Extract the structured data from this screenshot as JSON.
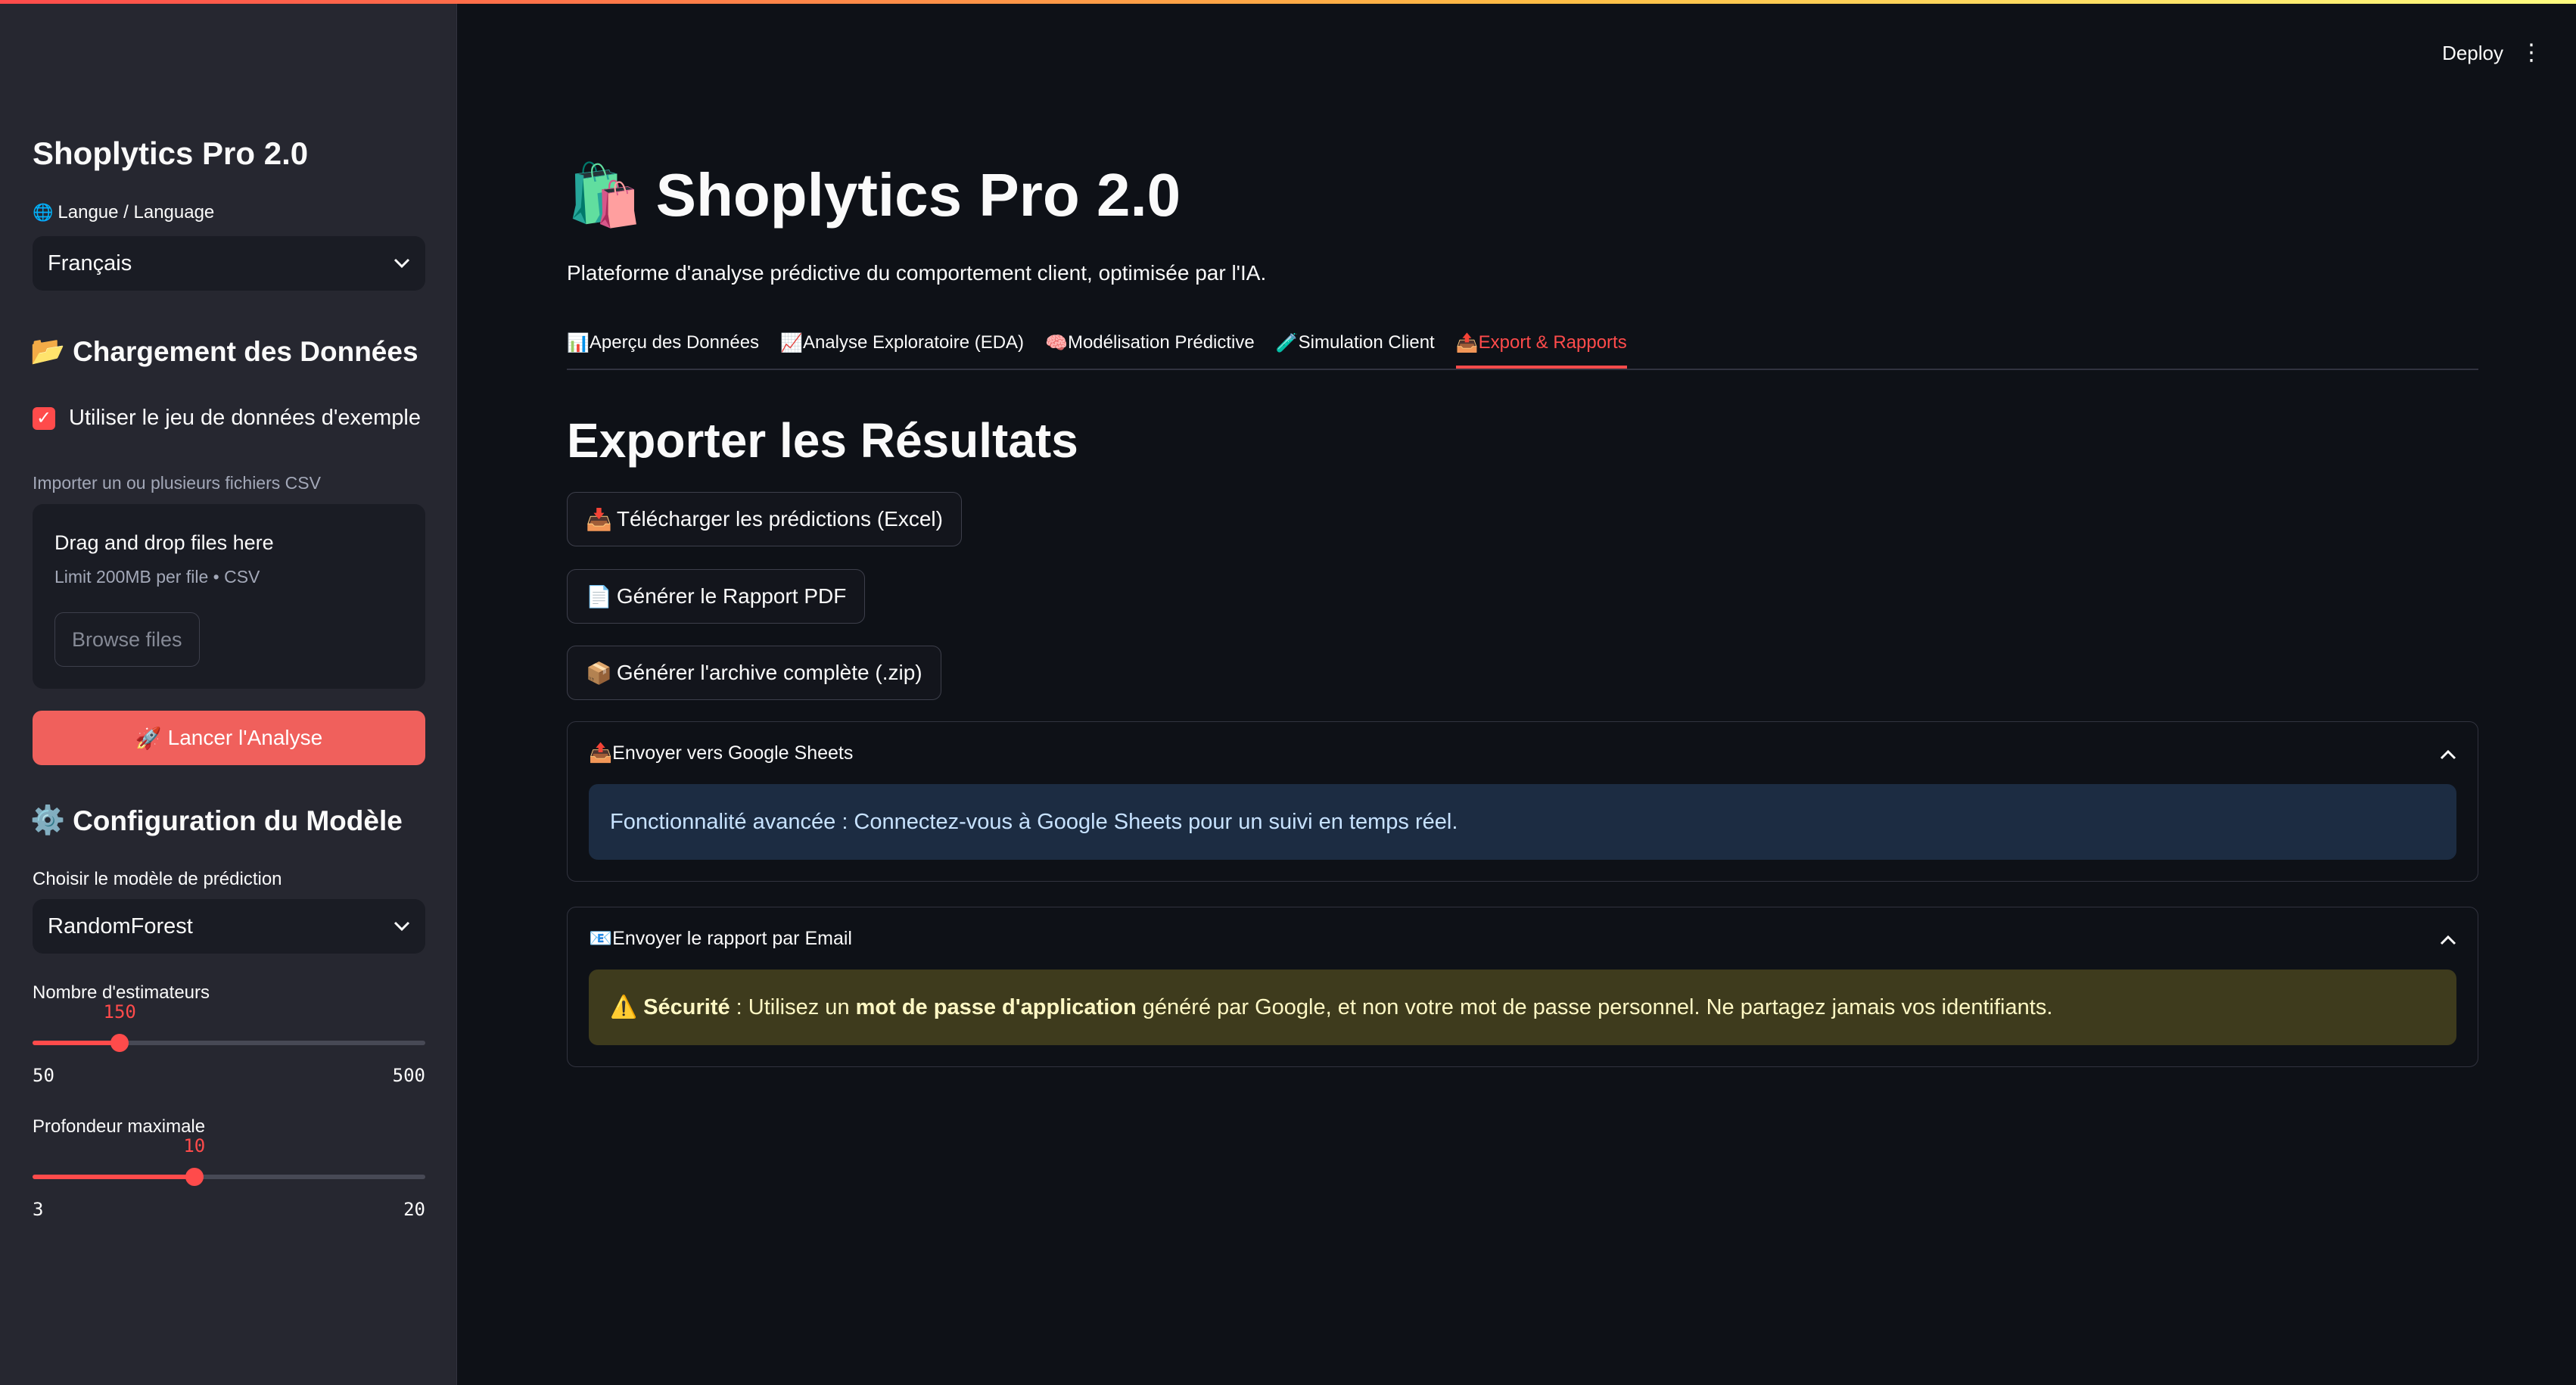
{
  "header": {
    "deploy_label": "Deploy",
    "menu_icon": "⋮"
  },
  "sidebar": {
    "title": "Shoplytics Pro 2.0",
    "language_label": "Langue / Language",
    "language_icon": "🌐",
    "language_value": "Français",
    "data_section_icon": "📂",
    "data_section_title": "Chargement des Données",
    "use_sample_label": "Utiliser le jeu de données d'exemple",
    "use_sample_checked": true,
    "upload_label": "Importer un ou plusieurs fichiers CSV",
    "dropzone_title": "Drag and drop files here",
    "dropzone_sub": "Limit 200MB per file • CSV",
    "browse_label": "Browse files",
    "run_icon": "🚀",
    "run_label": "Lancer l'Analyse",
    "model_section_icon": "⚙️",
    "model_section_title": "Configuration du Modèle",
    "model_label": "Choisir le modèle de prédiction",
    "model_value": "RandomForest",
    "estimators": {
      "label": "Nombre d'estimateurs",
      "value": "150",
      "min": "50",
      "max": "500",
      "fraction": 0.222
    },
    "depth": {
      "label": "Profondeur maximale",
      "value": "10",
      "min": "3",
      "max": "20",
      "fraction": 0.412
    }
  },
  "main": {
    "title_icon": "🛍️",
    "title": "Shoplytics Pro 2.0",
    "subtitle": "Plateforme d'analyse prédictive du comportement client, optimisée par l'IA.",
    "tabs": [
      {
        "icon": "📊",
        "label": "Aperçu des Données"
      },
      {
        "icon": "📈",
        "label": "Analyse Exploratoire (EDA)"
      },
      {
        "icon": "🧠",
        "label": "Modélisation Prédictive"
      },
      {
        "icon": "🧪",
        "label": "Simulation Client"
      },
      {
        "icon": "📤",
        "label": "Export & Rapports",
        "active": true
      }
    ],
    "section_title": "Exporter les Résultats",
    "buttons": {
      "excel": {
        "icon": "📥",
        "label": "Télécharger les prédictions (Excel)"
      },
      "pdf": {
        "icon": "📄",
        "label": "Générer le Rapport PDF"
      },
      "zip": {
        "icon": "📦",
        "label": "Générer l'archive complète (.zip)"
      }
    },
    "sheets_expander": {
      "icon": "📤",
      "title": "Envoyer vers Google Sheets",
      "info": "Fonctionnalité avancée : Connectez-vous à Google Sheets pour un suivi en temps réel."
    },
    "email_expander": {
      "icon": "📧",
      "title": "Envoyer le rapport par Email",
      "warn_icon": "⚠️",
      "warn_bold1": "Sécurité",
      "warn_text1": " : Utilisez un ",
      "warn_bold2": "mot de passe d'application",
      "warn_text2": " généré par Google, et non votre mot de passe personnel. Ne partagez jamais vos identifiants."
    }
  }
}
